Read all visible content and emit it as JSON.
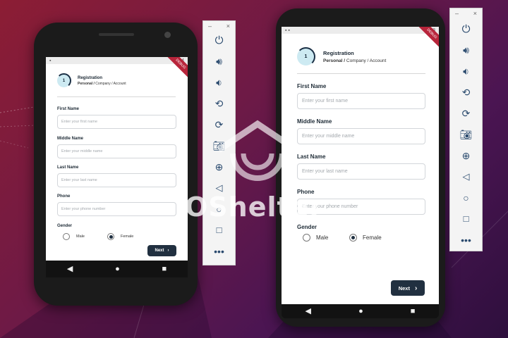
{
  "form": {
    "title": "Registration",
    "step_number": "1",
    "steps_current": "Personal /",
    "steps_rest": " Company / Account",
    "fields": [
      {
        "label": "First Name",
        "placeholder": "Enter your first name"
      },
      {
        "label": "Middle Name",
        "placeholder": "Enter your middle name"
      },
      {
        "label": "Last Name",
        "placeholder": "Enter your last name"
      },
      {
        "label": "Phone",
        "placeholder": "Enter your phone number"
      }
    ],
    "gender_label": "Gender",
    "gender_options": [
      "Male",
      "Female"
    ],
    "gender_selected": "Female",
    "next_label": "Next"
  },
  "status": {
    "time_left": "4:04",
    "time_right": "4:08",
    "debug_banner": "DEBUG"
  },
  "toolbar": {
    "minimize": "–",
    "close": "×",
    "icons": [
      "power-icon",
      "volume-up-icon",
      "volume-down-icon",
      "rotate-left-icon",
      "rotate-right-icon",
      "camera-icon",
      "zoom-in-icon",
      "back-icon",
      "home-icon",
      "overview-icon",
      "more-icon"
    ]
  },
  "watermark": "OShelter",
  "colors": {
    "accent": "#213040",
    "step_fill": "#cdeaf2",
    "background": "#6e1a46"
  }
}
